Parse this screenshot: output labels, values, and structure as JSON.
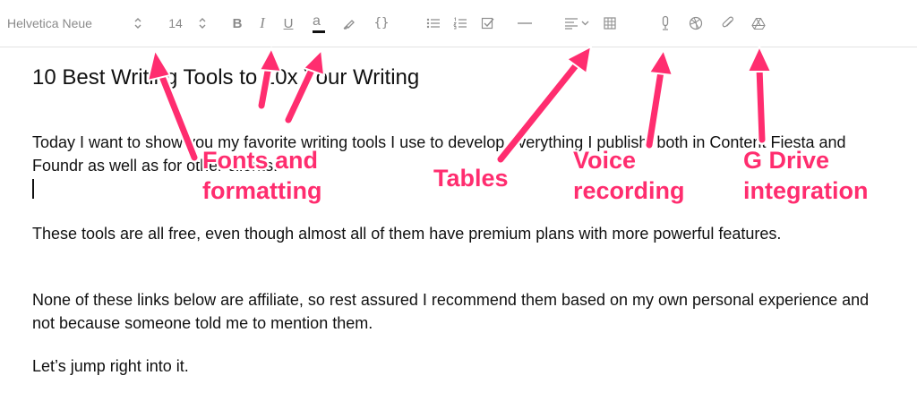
{
  "toolbar": {
    "font_family": "Helvetica Neue",
    "font_size": "14",
    "bold_label": "B",
    "italic_label": "I",
    "underline_label": "U",
    "text_color_label": "a",
    "code_label": "{}"
  },
  "document": {
    "title": "10 Best Writing Tools to 10x Your Writing",
    "paragraphs": [
      "Today I want to show you my favorite writing tools I use to develop everything I publish, both in Content Fiesta and Foundr as well as for other clients.",
      "These tools are all free, even though almost all of them have premium plans with more powerful features.",
      "None of these links below are affiliate, so rest assured I recommend them based on my own personal experience and not because someone told me to mention them.",
      "Let’s jump right into it."
    ]
  },
  "annotations": {
    "fonts": "Fonts and formatting",
    "tables": "Tables",
    "voice": "Voice recording",
    "gdrive": "G Drive integration"
  },
  "colors": {
    "annotation": "#ff2d6f",
    "icon": "#8e8e8e",
    "text": "#111111"
  },
  "icons": [
    "chevron-updown-icon",
    "highlighter-icon",
    "bullet-list-icon",
    "numbered-list-icon",
    "checklist-icon",
    "horizontal-rule-icon",
    "align-left-icon",
    "table-icon",
    "microphone-icon",
    "dribbble-icon",
    "paperclip-icon",
    "google-drive-icon"
  ]
}
